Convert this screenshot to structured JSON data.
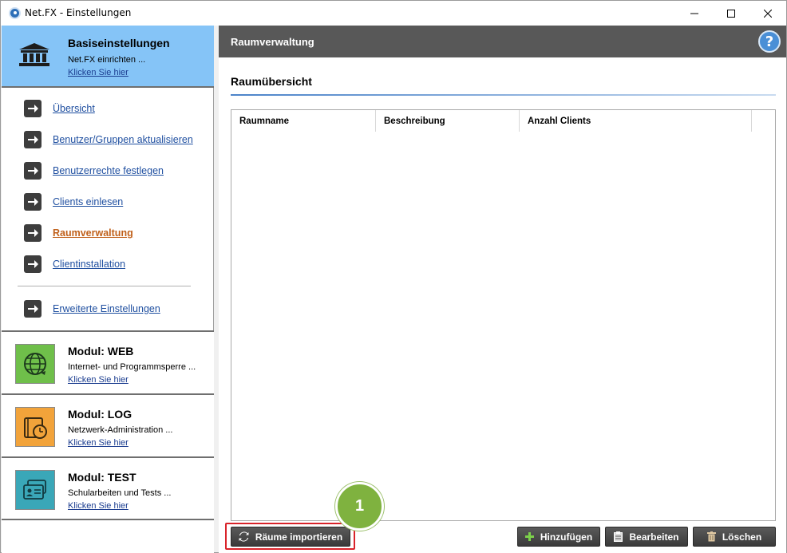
{
  "window": {
    "title": "Net.FX - Einstellungen",
    "minimize_icon": "minimize-icon",
    "maximize_icon": "maximize-icon",
    "close_icon": "close-icon"
  },
  "sidebar": {
    "basis": {
      "title": "Basiseinstellungen",
      "subtitle": "Net.FX einrichten ...",
      "link": "Klicken Sie hier",
      "icon": "bank-icon"
    },
    "nav": [
      {
        "label": "Übersicht"
      },
      {
        "label": "Benutzer/Gruppen aktualisieren"
      },
      {
        "label": "Benutzerrechte festlegen"
      },
      {
        "label": "Clients einlesen"
      },
      {
        "label": "Raumverwaltung",
        "active": true
      },
      {
        "label": "Clientinstallation"
      },
      {
        "label": "Erweiterte Einstellungen"
      }
    ],
    "modules": [
      {
        "title": "Modul: WEB",
        "subtitle": "Internet- und Programmsperre ...",
        "link": "Klicken Sie hier",
        "icon": "globe-icon",
        "color": "#6fbf4a"
      },
      {
        "title": "Modul: LOG",
        "subtitle": "Netzwerk-Administration ...",
        "link": "Klicken Sie hier",
        "icon": "clock-folder-icon",
        "color": "#f2a33a"
      },
      {
        "title": "Modul: TEST",
        "subtitle": "Schularbeiten und Tests ...",
        "link": "Klicken Sie hier",
        "icon": "exam-cards-icon",
        "color": "#3aa7b8"
      }
    ]
  },
  "main": {
    "header_title": "Raumverwaltung",
    "help_label": "?",
    "section_title": "Raumübersicht",
    "table": {
      "columns": [
        "Raumname",
        "Beschreibung",
        "Anzahl Clients"
      ],
      "rows": []
    },
    "buttons": {
      "import": "Räume importieren",
      "add": "Hinzufügen",
      "edit": "Bearbeiten",
      "delete": "Löschen"
    },
    "callout_number": "1"
  },
  "colors": {
    "accent": "#85c4f7",
    "header": "#585858",
    "callout": "#7fb23f",
    "highlight": "#d9232a",
    "active_link": "#c0601a"
  }
}
